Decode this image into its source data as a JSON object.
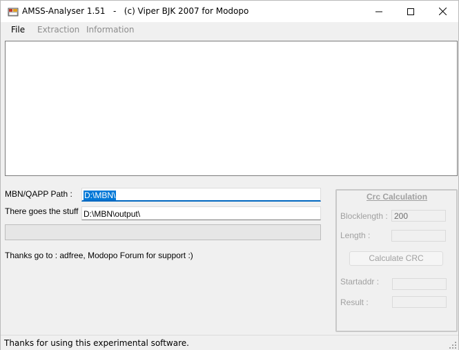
{
  "window": {
    "title": "AMSS-Analyser 1.51   -   (c) Viper BJK 2007 for Modopo",
    "controls": {
      "minimize_icon": "minimize-icon",
      "maximize_icon": "maximize-icon",
      "close_icon": "close-icon"
    }
  },
  "menu": {
    "items": [
      {
        "label": "File",
        "enabled": true
      },
      {
        "label": "Extraction",
        "enabled": false
      },
      {
        "label": "Information",
        "enabled": false
      }
    ]
  },
  "output": {
    "text": ""
  },
  "paths": {
    "mbn_label": "MBN/QAPP Path :",
    "mbn_value": "D:\\MBN\\",
    "output_label": "There goes the stuff :",
    "output_value": "D:\\MBN\\output\\"
  },
  "progress": {
    "value": 0
  },
  "thanks": "Thanks go to : adfree, Modopo Forum for support :)",
  "crc": {
    "title": "Crc Calculation",
    "blocklength_label": "Blocklength :",
    "blocklength_value": "200",
    "length_label": "Length :",
    "length_value": "",
    "button_label": "Calculate CRC",
    "startaddr_label": "Startaddr :",
    "startaddr_value": "",
    "result_label": "Result :",
    "result_value": ""
  },
  "status": {
    "text": "Thanks for using this experimental software."
  },
  "colors": {
    "accent": "#0078d7",
    "disabled_text": "#a0a0a0",
    "background": "#f0f0f0"
  }
}
